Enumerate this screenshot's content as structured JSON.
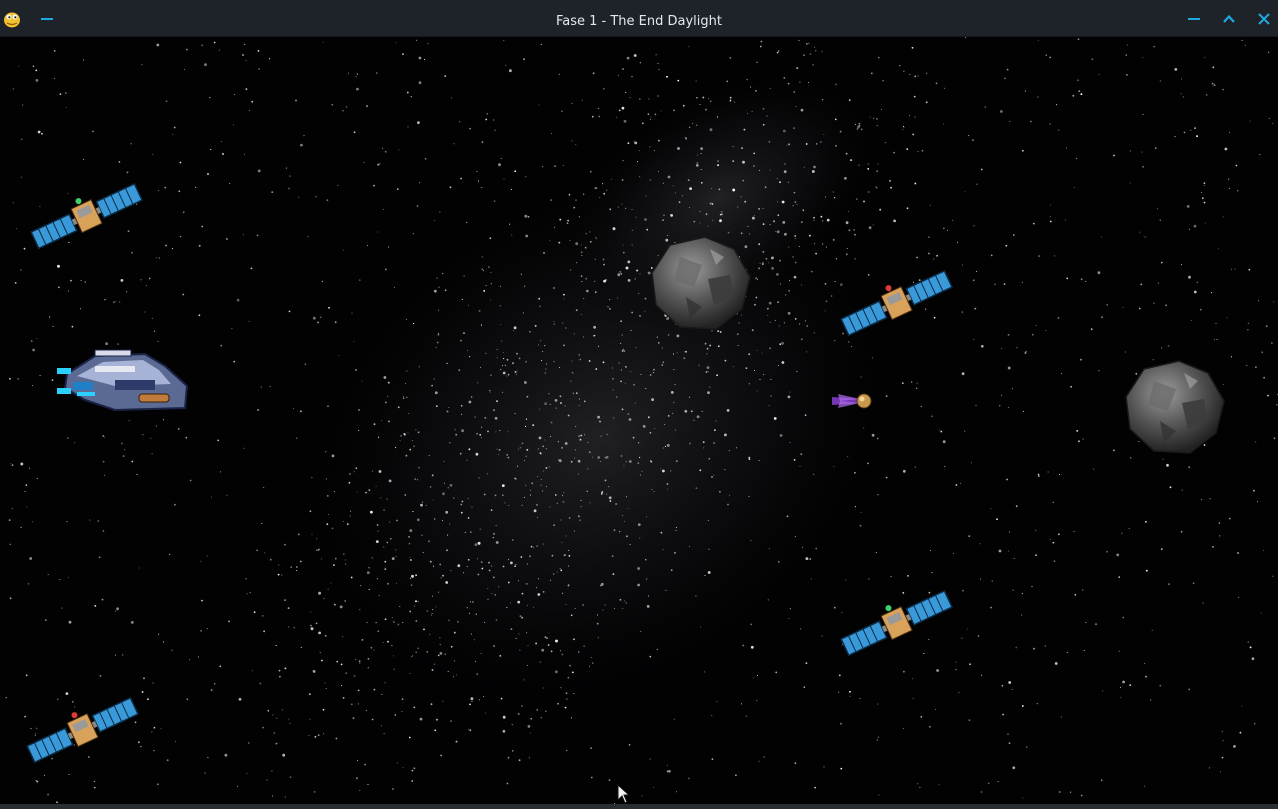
{
  "window": {
    "title": "Fase 1 - The End Daylight",
    "icons": {
      "app": "python-snake-icon",
      "minimize_left": "minimize-icon",
      "minimize": "minimize-icon",
      "maximize": "chevron-up-icon",
      "close": "close-icon"
    },
    "accent_color": "#1fa8e0",
    "titlebar_color": "#1e2229"
  },
  "game": {
    "background": "starfield",
    "sprites": [
      {
        "kind": "player-ship",
        "name": "player-spaceship"
      },
      {
        "kind": "satellite",
        "name": "enemy-satellite"
      },
      {
        "kind": "satellite",
        "name": "enemy-satellite"
      },
      {
        "kind": "satellite",
        "name": "enemy-satellite"
      },
      {
        "kind": "satellite",
        "name": "enemy-satellite"
      },
      {
        "kind": "asteroid",
        "name": "asteroid"
      },
      {
        "kind": "asteroid",
        "name": "asteroid"
      },
      {
        "kind": "projectile",
        "name": "projectile"
      }
    ]
  }
}
